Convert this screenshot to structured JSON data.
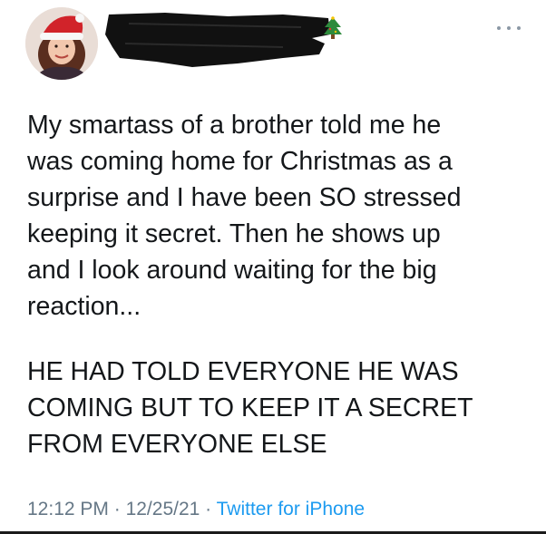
{
  "tweet": {
    "author_name": "[redacted]",
    "author_handle": "[redacted]",
    "name_emoji_icon": "christmas-tree-icon",
    "more_icon": "more-horizontal-icon",
    "avatar_icon": "profile-photo-santa-hat",
    "paragraph_1": "My smartass of a brother told me he\nwas coming home for Christmas as a\nsurprise and I have been SO stressed\nkeeping it secret. Then he shows up\nand I look around waiting for the big\nreaction...",
    "paragraph_2": "HE HAD TOLD EVERYONE HE WAS\nCOMING BUT TO KEEP IT A SECRET\nFROM EVERYONE ELSE",
    "time": "12:12 PM",
    "separator": "·",
    "date": "12/25/21",
    "source": "Twitter for iPhone"
  },
  "colors": {
    "text": "#14171a",
    "meta": "#657786",
    "link": "#1d9bf0",
    "redaction": "#111111"
  }
}
